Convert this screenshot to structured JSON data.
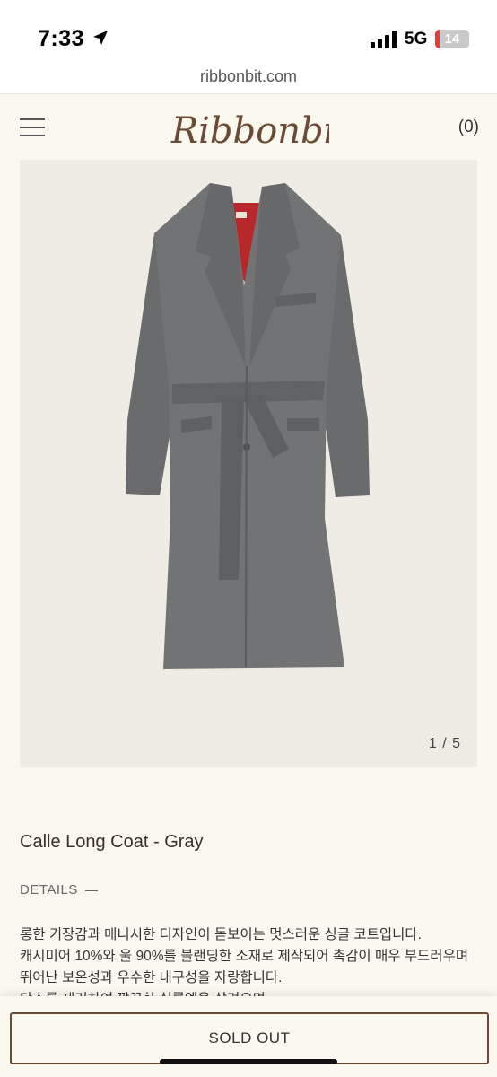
{
  "status_bar": {
    "time": "7:33",
    "network": "5G",
    "battery_level": "14",
    "battery_fraction": 0.14,
    "battery_color": "#e63b3b",
    "icons": [
      "location-arrow-icon",
      "signal-icon",
      "battery-icon"
    ]
  },
  "browser": {
    "url": "ribbonbit.com"
  },
  "header": {
    "logo_text": "Ribbonbit",
    "cart_label": "(0)",
    "icons": [
      "menu-icon"
    ]
  },
  "product": {
    "image_counter": "1 / 5",
    "name": "Calle Long Coat - Gray",
    "details_label": "DETAILS",
    "description_lines": [
      "롱한 기장감과 매니시한 디자인이 돋보이는 멋스러운 싱글 코트입니다.",
      "캐시미어 10%와 울 90%를 블랜딩한 소재로 제작되어 촉감이 매우 부드러우며",
      "뛰어난 보온성과 우수한 내구성을 자랑합니다.",
      "단추를 제거하여 깔끔한 실루엣을 살려으며"
    ]
  },
  "actions": {
    "sold_out_label": "SOLD OUT"
  },
  "colors": {
    "background": "#fbf8ef",
    "brand": "#6b4a36",
    "coat": "#6e6f70",
    "lining": "#b8282a"
  }
}
